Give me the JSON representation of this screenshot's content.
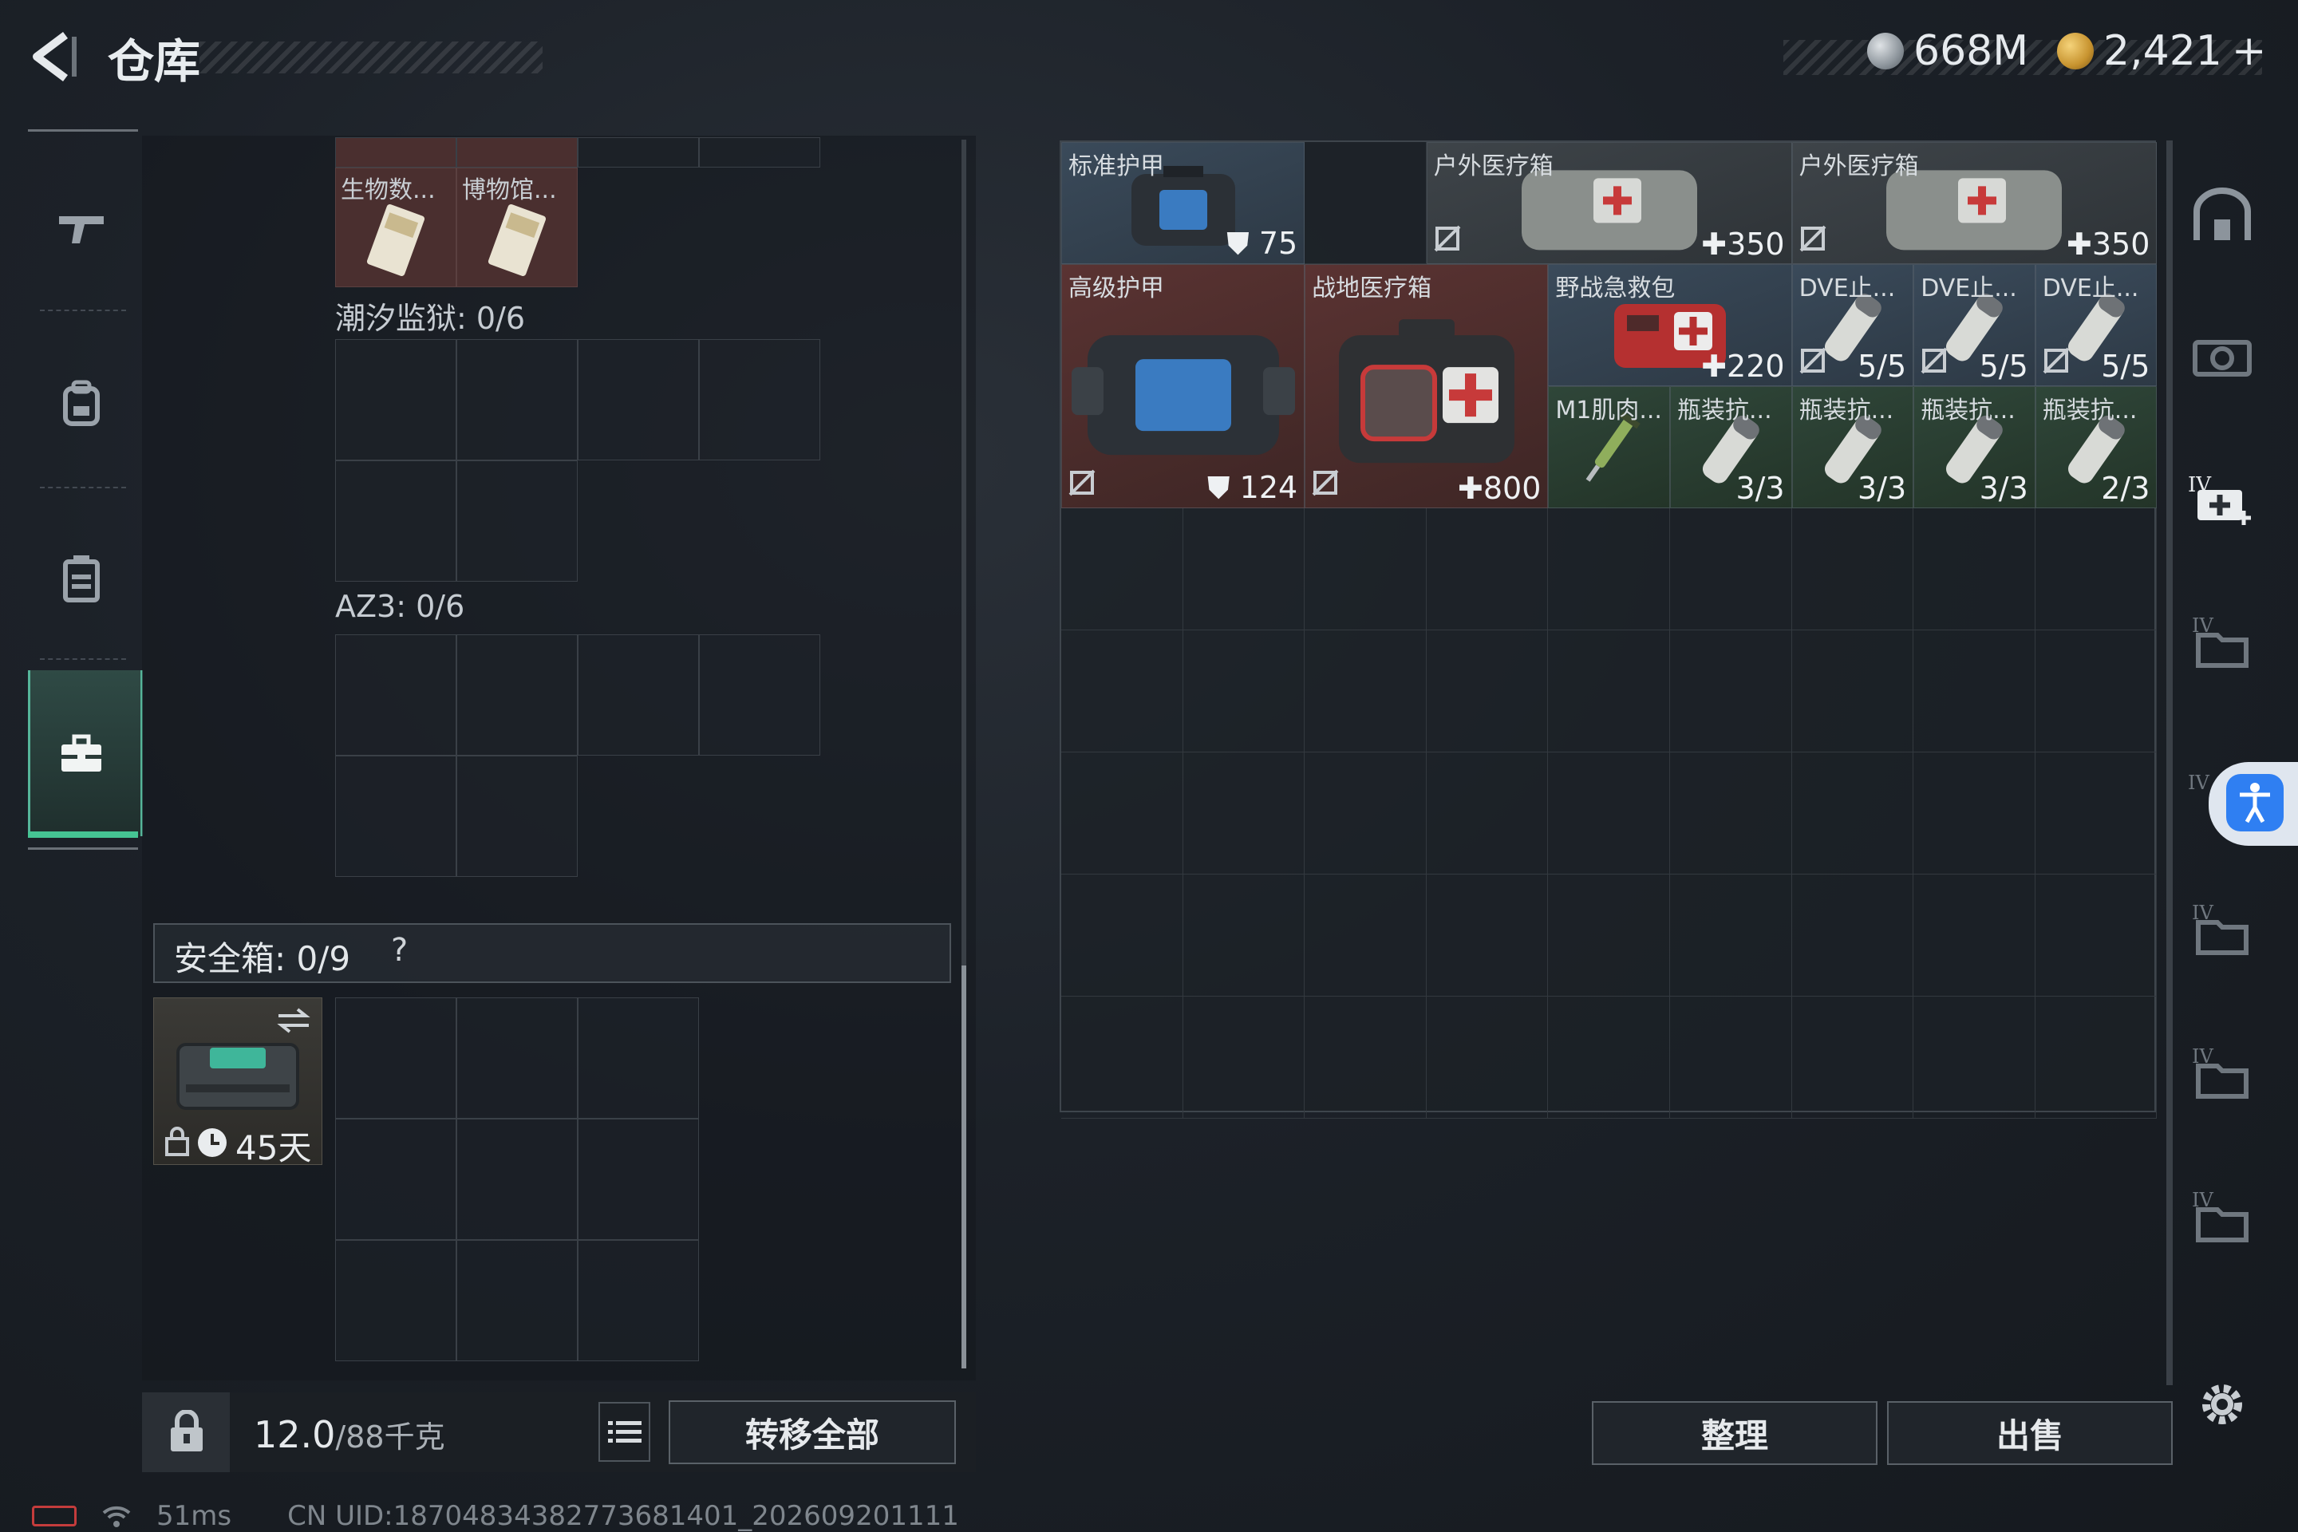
{
  "header": {
    "back_icon": "back-arrow-icon",
    "title": "仓库"
  },
  "currency": [
    {
      "icon": "silver-coin-icon",
      "value": "668M"
    },
    {
      "icon": "gold-coin-icon",
      "value": "2,421",
      "add_label": "+"
    }
  ],
  "sidebar": {
    "items": [
      {
        "icon": "gun-icon"
      },
      {
        "icon": "backpack-icon"
      },
      {
        "icon": "vest-icon"
      },
      {
        "icon": "toolbox-icon",
        "active": true
      }
    ]
  },
  "left": {
    "cards": [
      {
        "name": "生物数..."
      },
      {
        "name": "博物馆..."
      }
    ],
    "container1": {
      "label": "潮汐监狱: 0/6"
    },
    "container2": {
      "label": "AZ3: 0/6"
    },
    "safebox": {
      "label": "安全箱: 0/9",
      "help": "?",
      "days": "45天"
    }
  },
  "bottom_left": {
    "weight": "12.0",
    "weight_unit": "/88千克",
    "transfer_label": "转移全部"
  },
  "stash": {
    "items": [
      {
        "name": "标准护甲",
        "value": "75",
        "value_icon": "shield-icon"
      },
      {
        "name": "户外医疗箱",
        "value": "350",
        "value_icon": "plus-icon",
        "no_sell": true
      },
      {
        "name": "户外医疗箱",
        "value": "350",
        "value_icon": "plus-icon",
        "no_sell": true
      },
      {
        "name": "高级护甲",
        "value": "124",
        "value_icon": "shield-icon",
        "no_sell": true
      },
      {
        "name": "战地医疗箱",
        "value": "800",
        "value_icon": "plus-icon",
        "no_sell": true
      },
      {
        "name": "野战急救包",
        "value": "220",
        "value_icon": "plus-icon"
      },
      {
        "name": "DVE止...",
        "value": "5/5",
        "no_sell": true
      },
      {
        "name": "DVE止...",
        "value": "5/5",
        "no_sell": true
      },
      {
        "name": "DVE止...",
        "value": "5/5",
        "no_sell": true
      },
      {
        "name": "M1肌肉...",
        "value": ""
      },
      {
        "name": "瓶装抗...",
        "value": "3/3"
      },
      {
        "name": "瓶装抗...",
        "value": "3/3"
      },
      {
        "name": "瓶装抗...",
        "value": "3/3"
      },
      {
        "name": "瓶装抗...",
        "value": "2/3"
      }
    ]
  },
  "bottom_right": {
    "sort_label": "整理",
    "sell_label": "出售"
  },
  "status": {
    "ping": "51ms",
    "uid": "CN UID:18704834382773681401_202609201111"
  }
}
